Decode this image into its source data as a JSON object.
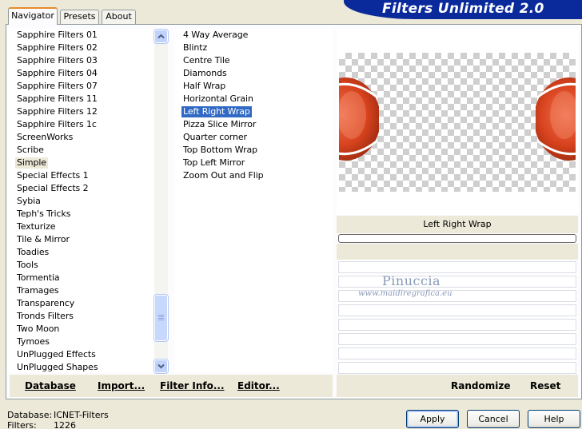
{
  "banner": {
    "title": "Filters Unlimited 2.0"
  },
  "tabs": [
    {
      "label": "Navigator",
      "active": true
    },
    {
      "label": "Presets",
      "active": false
    },
    {
      "label": "About",
      "active": false
    }
  ],
  "categories": {
    "items": [
      "Sapphire Filters 01",
      "Sapphire Filters 02",
      "Sapphire Filters 03",
      "Sapphire Filters 04",
      "Sapphire Filters 07",
      "Sapphire Filters 11",
      "Sapphire Filters 12",
      "Sapphire Filters 1c",
      "ScreenWorks",
      "Scribe",
      "Simple",
      "Special Effects 1",
      "Special Effects 2",
      "Sybia",
      "Teph's Tricks",
      "Texturize",
      "Tile & Mirror",
      "Toadies",
      "Tools",
      "Tormentia",
      "Tramages",
      "Transparency",
      "Tronds Filters",
      "Two Moon",
      "Tymoes",
      "UnPlugged Effects",
      "UnPlugged Shapes"
    ],
    "selected": "Simple"
  },
  "filters": {
    "items": [
      "4 Way Average",
      "Blintz",
      "Centre Tile",
      "Diamonds",
      "Half Wrap",
      "Horizontal Grain",
      "Left Right Wrap",
      "Pizza Slice Mirror",
      "Quarter corner",
      "Top Bottom Wrap",
      "Top Left Mirror",
      "Zoom Out and Flip"
    ],
    "selected": "Left Right Wrap"
  },
  "preview": {
    "filter_name": "Left Right Wrap",
    "watermark_name": "Pinuccia",
    "watermark_url": "www.maidiregrafica.eu"
  },
  "toolbar": {
    "database": "Database",
    "import": "Import...",
    "filter_info": "Filter Info...",
    "editor": "Editor...",
    "randomize": "Randomize",
    "reset": "Reset"
  },
  "status": {
    "database_label": "Database:",
    "database_value": "ICNET-Filters",
    "filters_label": "Filters:",
    "filters_value": "1226"
  },
  "dialog": {
    "apply": "Apply",
    "cancel": "Cancel",
    "help": "Help"
  },
  "colors": {
    "selection": "#316ac5",
    "banner": "#0a2a9c",
    "dialog_bg": "#ece9d8"
  }
}
